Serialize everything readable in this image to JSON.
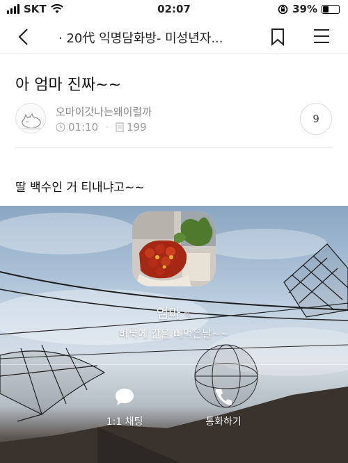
{
  "status_bar": {
    "carrier": "SKT",
    "time": "02:07",
    "battery": "39%",
    "battery_level": 0.39
  },
  "nav": {
    "title": "· 20代 익명담화방- 미성년자..."
  },
  "post": {
    "title": "아 엄마 진짜~~",
    "author": "오마이갓나는왜이럴까",
    "time": "01:10",
    "views": "199",
    "comment_count": "9",
    "body": "딸 백수인 거 티내냐고~~"
  },
  "profile": {
    "name": "엄마",
    "status_message": "벼룩에 간을 빼먹은날~~",
    "actions": [
      {
        "label": "1:1 채팅",
        "icon": "chat-bubble-icon"
      },
      {
        "label": "통화하기",
        "icon": "phone-icon"
      }
    ]
  },
  "colors": {
    "text": "#222222",
    "meta": "#9a9a9a",
    "divider": "#e8e8e8"
  }
}
